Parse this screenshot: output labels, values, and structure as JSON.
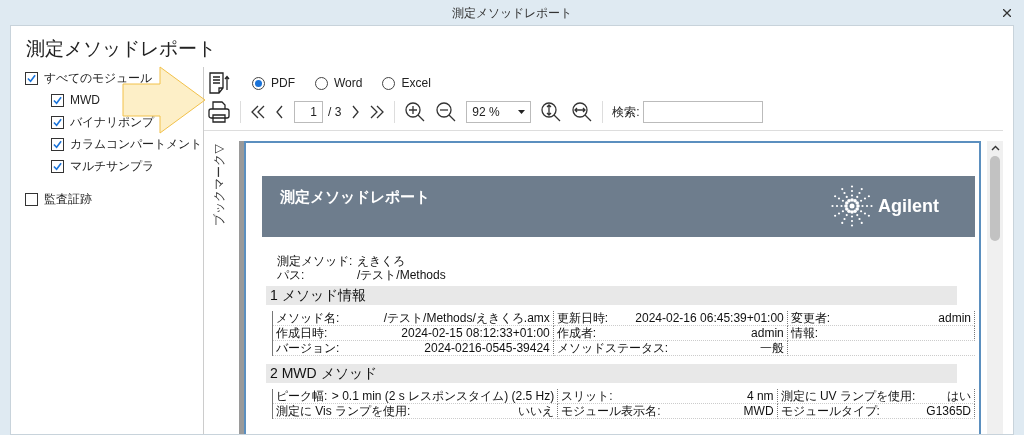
{
  "window": {
    "title": "測定メソッドレポート"
  },
  "heading": "測定メソッドレポート",
  "modules": {
    "label": "すべてのモジュール",
    "checked": true,
    "children": [
      {
        "label": "MWD",
        "checked": true
      },
      {
        "label": "バイナリポンプ",
        "checked": true
      },
      {
        "label": "カラムコンパートメント",
        "checked": true
      },
      {
        "label": "マルチサンプラ",
        "checked": true
      }
    ]
  },
  "audit_trail": {
    "label": "監査証跡",
    "checked": false
  },
  "formats": [
    {
      "label": "PDF",
      "selected": true
    },
    {
      "label": "Word",
      "selected": false
    },
    {
      "label": "Excel",
      "selected": false
    }
  ],
  "pager": {
    "page": "1",
    "total": "/ 3"
  },
  "zoom": {
    "value": "92 %"
  },
  "search": {
    "label": "検索:"
  },
  "bookmark_tab": {
    "arrow": "▷",
    "label": "ブックマーク"
  },
  "report": {
    "banner_title": "測定メソッドレポート",
    "logo": "Agilent",
    "meta": [
      {
        "label": "測定メソッド:",
        "value": "えきくろ"
      },
      {
        "label": "パス:",
        "value": "/テスト/Methods"
      }
    ],
    "sections": [
      {
        "title": "1 メソッド情報",
        "rows": [
          [
            {
              "label": "メソッド名:",
              "value": "/テスト/Methods/えきくろ.amx"
            },
            {
              "label": "更新日時:",
              "value": "2024-02-16 06:45:39+01:00"
            },
            {
              "label": "変更者:",
              "value": "admin"
            }
          ],
          [
            {
              "label": "作成日時:",
              "value": "2024-02-15 08:12:33+01:00"
            },
            {
              "label": "作成者:",
              "value": "admin"
            },
            {
              "label": "情報:"
            }
          ],
          [
            {
              "label": "バージョン:",
              "value": "2024-0216-0545-39424"
            },
            {
              "label": "メソッドステータス:",
              "value": "一般"
            }
          ]
        ]
      },
      {
        "title": "2 MWD メソッド",
        "rows": [
          [
            {
              "label": "ピーク幅:",
              "value": "> 0.1 min (2 s レスポンスタイム) (2.5 Hz)"
            },
            {
              "label": "スリット:",
              "value": "4 nm"
            },
            {
              "label": "測定に UV ランプを使用:",
              "value": "はい"
            }
          ],
          [
            {
              "label": "測定に Vis ランプを使用:",
              "value": "いいえ"
            },
            {
              "label": "モジュール表示名:",
              "value": "MWD"
            },
            {
              "label": "モジュールタイプ:",
              "value": "G1365D"
            }
          ]
        ]
      }
    ]
  }
}
